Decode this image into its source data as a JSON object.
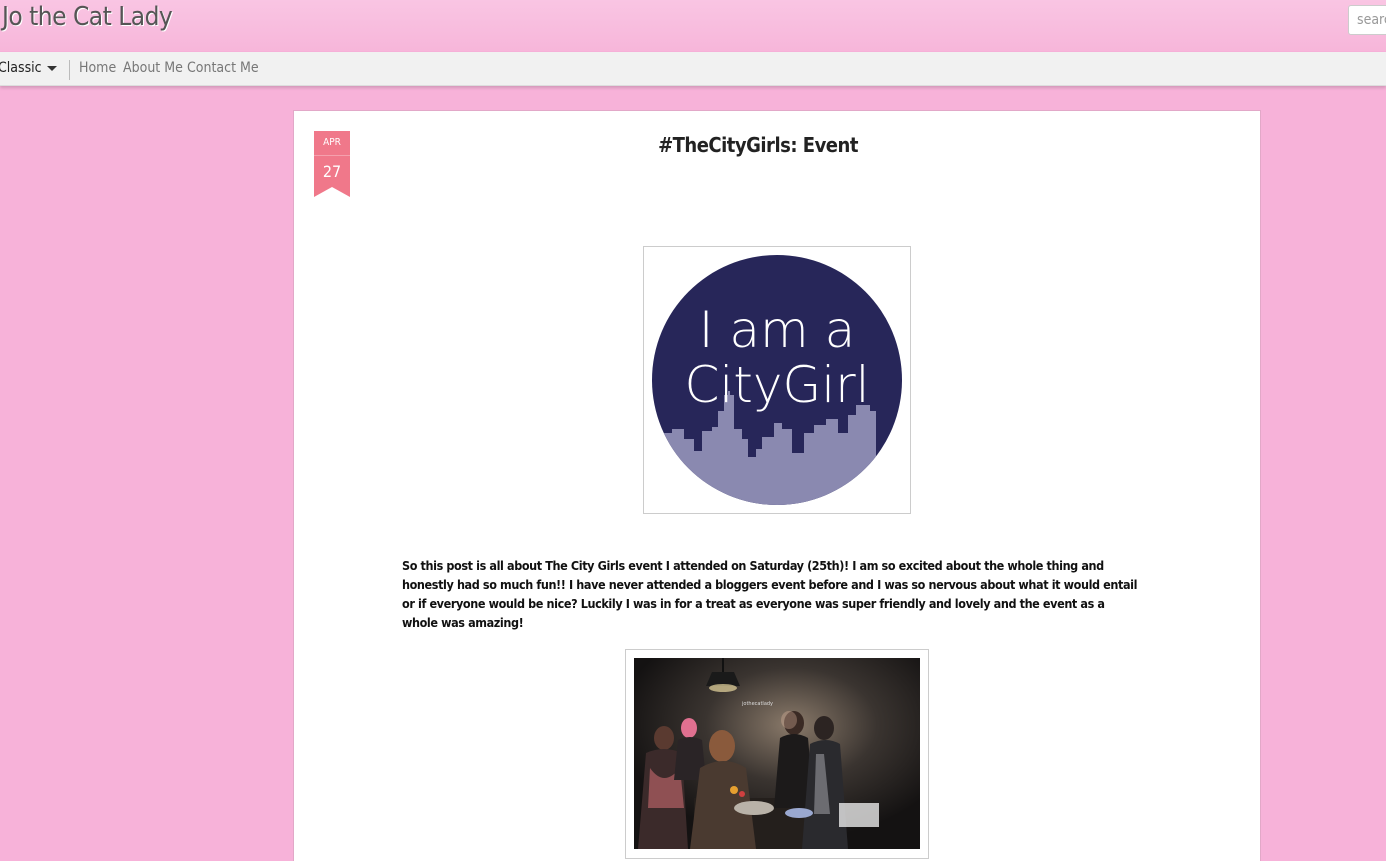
{
  "header": {
    "blog_title": "Jo the Cat Lady",
    "search_placeholder": "search"
  },
  "navbar": {
    "view_label": "Classic",
    "links": [
      "Home",
      "About Me",
      "Contact Me"
    ]
  },
  "post": {
    "date_month": "APR",
    "date_day": "27",
    "title": "#TheCityGirls: Event",
    "logo_line1": "I am a",
    "logo_line2": "CityGirl",
    "body": "So this post is all about The City Girls event I attended on Saturday (25th)! I am so excited about the whole thing and honestly had so much fun!! I have never attended a bloggers event before and I was so nervous about what it would entail or if everyone would be nice? Luckily I was in for a treat as everyone was super friendly and lovely and the event as a whole was amazing!",
    "photo_watermark": "jothecatlady"
  },
  "colors": {
    "background": "#f7b2d9",
    "ribbon": "#f0788a",
    "logo_navy": "#272659",
    "logo_skyline": "#8a89b0"
  }
}
